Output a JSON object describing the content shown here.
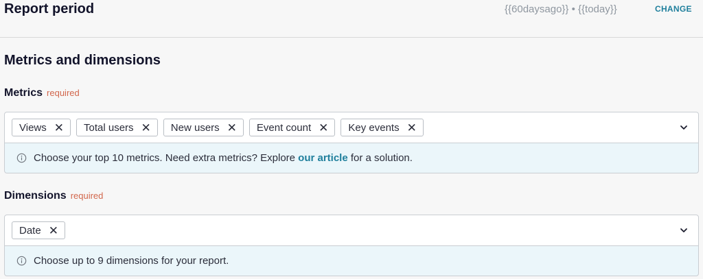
{
  "report_period": {
    "title": "Report period",
    "dates": "{{60daysago}} • {{today}}",
    "change_label": "CHANGE"
  },
  "metrics_dimensions": {
    "title": "Metrics and dimensions"
  },
  "metrics": {
    "label": "Metrics",
    "required_label": "required",
    "chips": [
      "Views",
      "Total users",
      "New users",
      "Event count",
      "Key events"
    ],
    "info_before": "Choose your top 10 metrics. Need extra metrics? Explore ",
    "info_link": "our article",
    "info_after": " for a solution."
  },
  "dimensions": {
    "label": "Dimensions",
    "required_label": "required",
    "chips": [
      "Date"
    ],
    "info": "Choose up to 9 dimensions for your report."
  },
  "icons": {
    "chip_remove": "close-icon",
    "dropdown": "chevron-down-icon",
    "info": "info-circle-icon"
  },
  "colors": {
    "accent": "#1f7f9c",
    "required": "#d2674c",
    "info_bg": "#ebf6fa"
  }
}
